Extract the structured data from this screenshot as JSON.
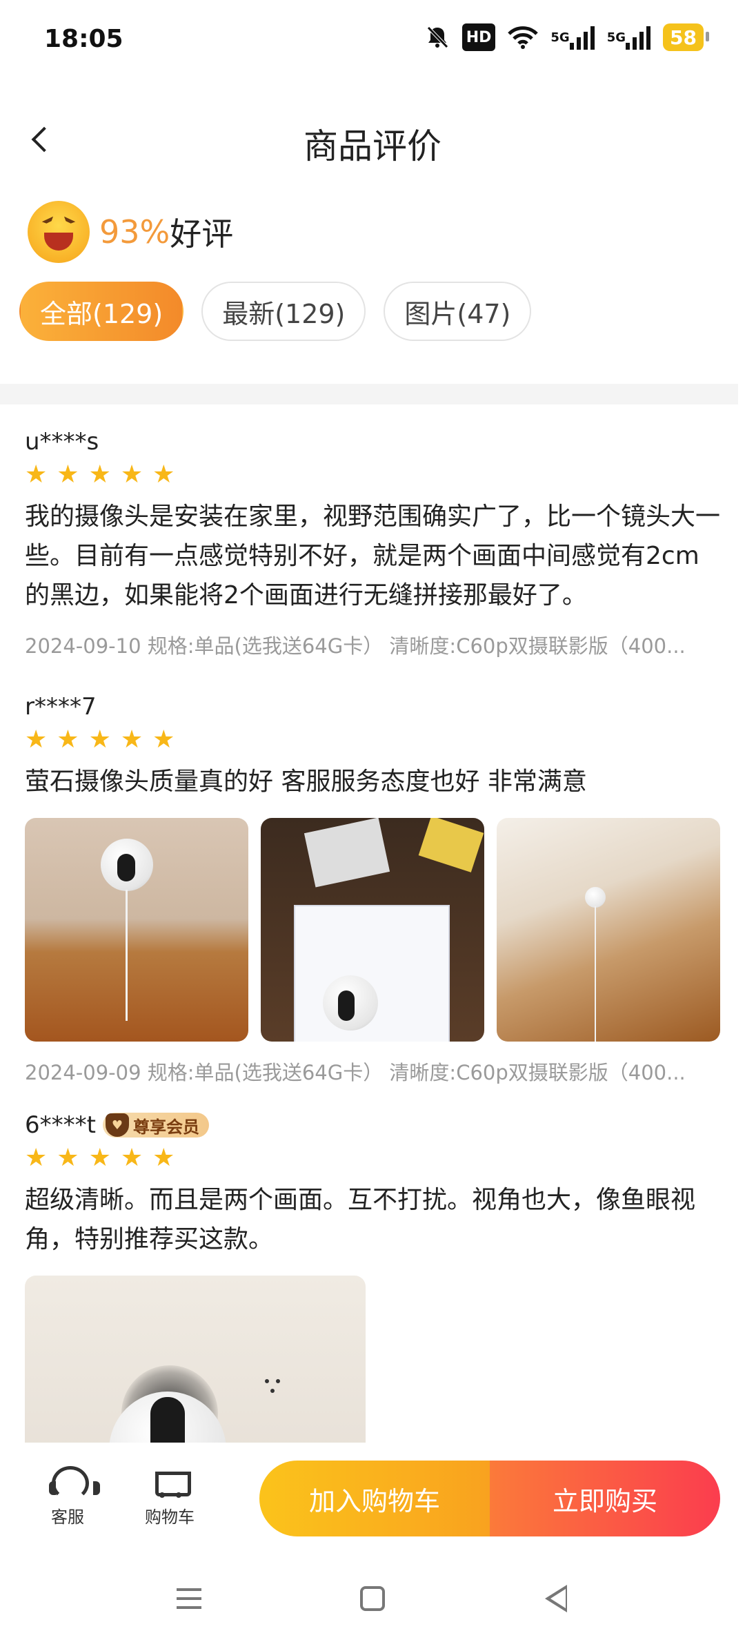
{
  "status_bar": {
    "time": "18:05",
    "icons": [
      "bell-off-icon",
      "hd-icon",
      "wifi-icon",
      "5g-signal-icon",
      "5g-signal-icon",
      "battery-icon"
    ],
    "hd_label": "HD",
    "net_label_1": "5G",
    "net_label_2": "5G",
    "battery": "58"
  },
  "header": {
    "title": "商品评价"
  },
  "summary": {
    "percent": "93%",
    "label": "好评"
  },
  "tabs": [
    {
      "label": "全部(129)",
      "active": true
    },
    {
      "label": "最新(129)",
      "active": false
    },
    {
      "label": "图片(47)",
      "active": false
    }
  ],
  "reviews": [
    {
      "user": "u****s",
      "stars": 5,
      "text": "我的摄像头是安装在家里，视野范围确实广了，比一个镜头大一些。目前有一点感觉特别不好，就是两个画面中间感觉有2cm的黑边，如果能将2个画面进行无缝拼接那最好了。",
      "meta": "2024-09-10 规格:单品(选我送64G卡）  清晰度:C60p双摄联影版（400..."
    },
    {
      "user": "r****7",
      "stars": 5,
      "text": "萤石摄像头质量真的好 客服服务态度也好 非常满意",
      "photos": 3,
      "meta": "2024-09-09 规格:单品(选我送64G卡）  清晰度:C60p双摄联影版（400..."
    },
    {
      "user": "6****t",
      "badge": "尊享会员",
      "stars": 5,
      "text": "超级清晰。而且是两个画面。互不打扰。视角也大，像鱼眼视角，特别推荐买这款。",
      "photos": 1
    }
  ],
  "bottom_bar": {
    "service_label": "客服",
    "cart_label": "购物车",
    "add_cart": "加入购物车",
    "buy_now": "立即购买",
    "colors": {
      "add": "#fbb81e",
      "buy": "#fb4a47",
      "accent": "#f39a3b"
    }
  },
  "nav_bar": {
    "icons": [
      "menu-icon",
      "home-icon",
      "back-icon"
    ]
  }
}
